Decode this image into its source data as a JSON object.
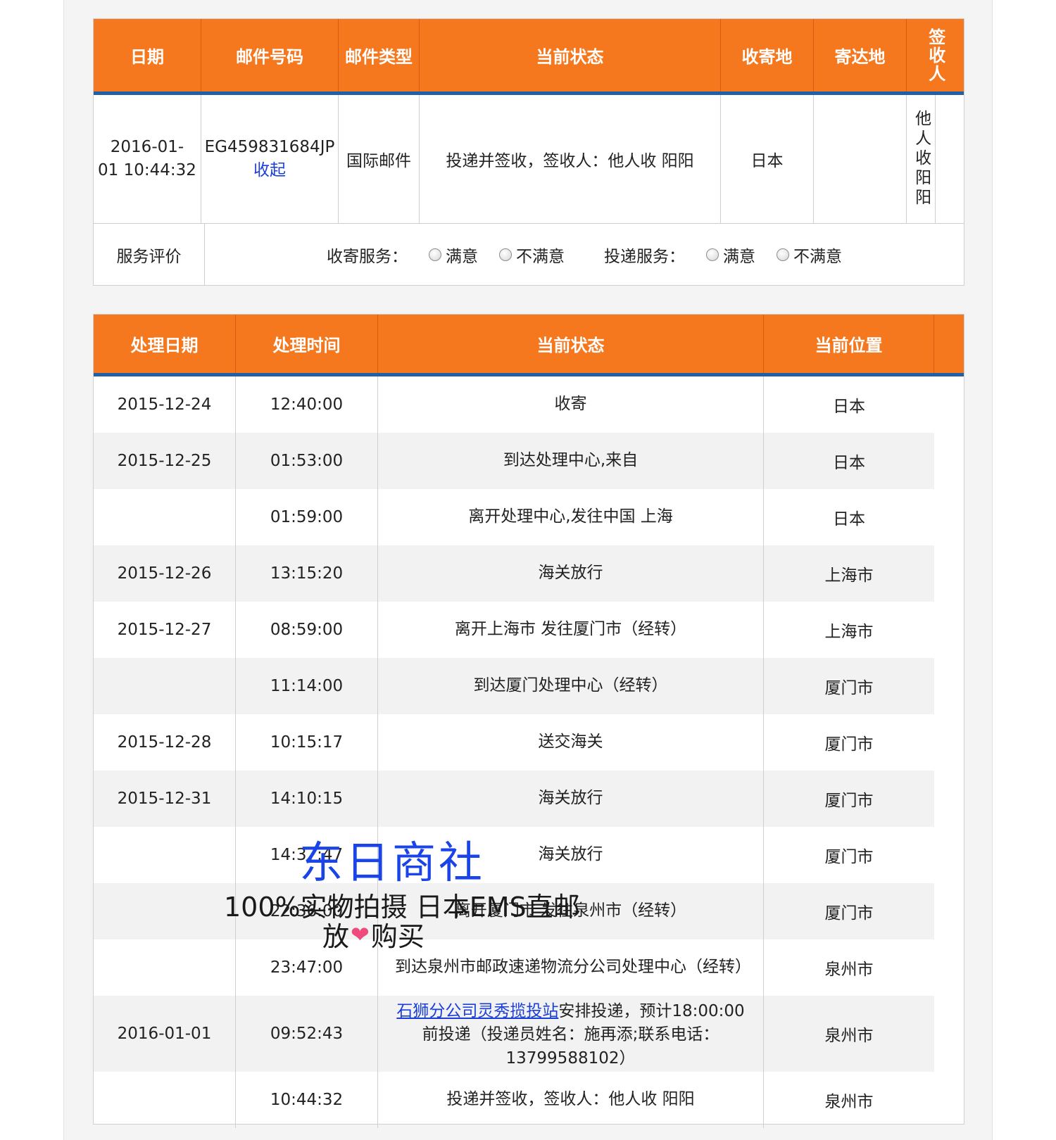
{
  "summary": {
    "headers": [
      "日期",
      "邮件号码",
      "邮件类型",
      "当前状态",
      "收寄地",
      "寄达地",
      "签收人"
    ],
    "row": {
      "date_line1": "2016-01-",
      "date_line2": "01 10:44:32",
      "tracking_number": "EG459831684JP",
      "collapse_link": "收起",
      "mail_type": "国际邮件",
      "status": "投递并签收，签收人：他人收 阳阳",
      "origin": "日本",
      "destination": "",
      "signer": "他人收阳阳"
    },
    "rating": {
      "label": "服务评价",
      "pickup_label": "收寄服务：",
      "delivery_label": "投递服务：",
      "satisfied": "满意",
      "unsatisfied": "不满意"
    }
  },
  "tracking": {
    "headers": [
      "处理日期",
      "处理时间",
      "当前状态",
      "当前位置"
    ],
    "rows": [
      {
        "date": "2015-12-24",
        "time": "12:40:00",
        "status": "收寄",
        "location": "日本"
      },
      {
        "date": "2015-12-25",
        "time": "01:53:00",
        "status": "到达处理中心,来自",
        "location": "日本"
      },
      {
        "date": "",
        "time": "01:59:00",
        "status": "离开处理中心,发往中国 上海",
        "location": "日本"
      },
      {
        "date": "2015-12-26",
        "time": "13:15:20",
        "status": "海关放行",
        "location": "上海市"
      },
      {
        "date": "2015-12-27",
        "time": "08:59:00",
        "status": "离开上海市 发往厦门市（经转）",
        "location": "上海市"
      },
      {
        "date": "",
        "time": "11:14:00",
        "status": "到达厦门处理中心（经转）",
        "location": "厦门市"
      },
      {
        "date": "2015-12-28",
        "time": "10:15:17",
        "status": "送交海关",
        "location": "厦门市"
      },
      {
        "date": "2015-12-31",
        "time": "14:10:15",
        "status": "海关放行",
        "location": "厦门市"
      },
      {
        "date": "",
        "time": "14:37:47",
        "status": "海关放行",
        "location": "厦门市"
      },
      {
        "date": "",
        "time": "22:36:00",
        "status": "离开厦门市 发往泉州市（经转）",
        "location": "厦门市"
      },
      {
        "date": "",
        "time": "23:47:00",
        "status": "到达泉州市邮政速递物流分公司处理中心（经转）",
        "location": "泉州市"
      },
      {
        "date": "2016-01-01",
        "time": "09:52:43",
        "status_link": "石狮分公司灵秀揽投站",
        "status": "安排投递，预计18:00:00前投递（投递员姓名：施再添;联系电话：13799588102）",
        "location": "泉州市"
      },
      {
        "date": "",
        "time": "10:44:32",
        "status": "投递并签收，签收人：他人收 阳阳",
        "location": "泉州市"
      }
    ]
  },
  "watermark": {
    "title": "东日商社",
    "line1": "100%实物拍摄 日本EMS直邮",
    "line2_a": "放",
    "line2_b": "购买"
  },
  "colors": {
    "header_orange": "#f5781e",
    "header_underline_blue": "#2160a8",
    "link_blue": "#1a3fd8",
    "alt_row": "#f2f2f2"
  }
}
